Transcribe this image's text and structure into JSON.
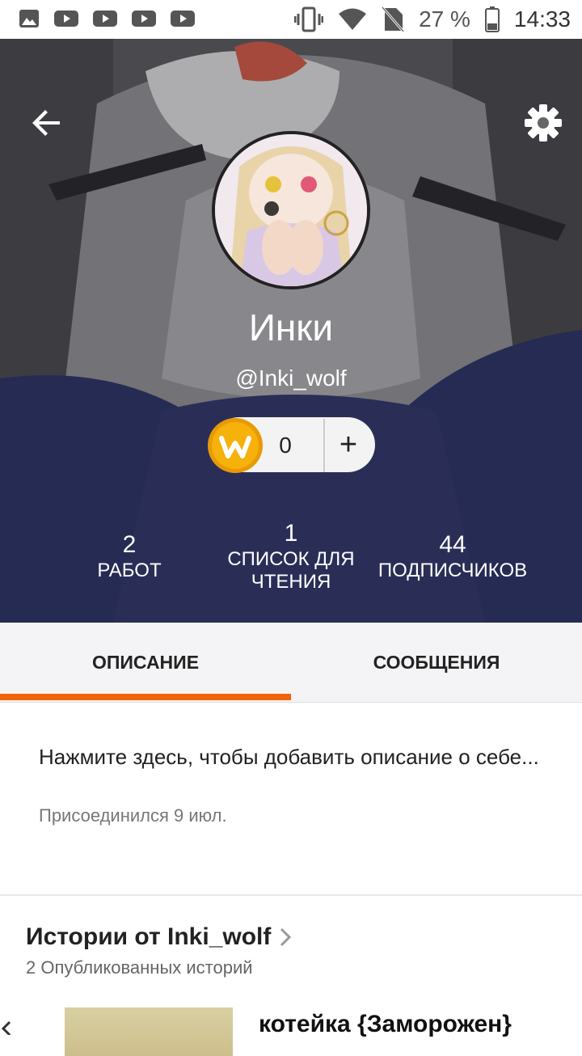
{
  "status_bar": {
    "battery": "27 %",
    "time": "14:33"
  },
  "profile": {
    "display_name": "Инки",
    "username": "@Inki_wolf",
    "coins": "0",
    "coin_add": "+"
  },
  "stats": [
    {
      "value": "2",
      "label": "РАБОТ"
    },
    {
      "value": "1",
      "label": "СПИСОК ДЛЯ ЧТЕНИЯ"
    },
    {
      "value": "44",
      "label": "ПОДПИСЧИКОВ"
    }
  ],
  "tabs": [
    {
      "label": "ОПИСАНИЕ",
      "active": true
    },
    {
      "label": "СООБЩЕНИЯ",
      "active": false
    }
  ],
  "about": {
    "description_prompt": "Нажмите здесь, чтобы добавить описание о себе...",
    "joined": "Присоединился 9 июл."
  },
  "stories": {
    "heading": "Истории от Inki_wolf",
    "count_label": "2 Опубликованных историй",
    "items": [
      {
        "title": "котейка {Заморожен}"
      }
    ]
  },
  "colors": {
    "accent": "#f0620c",
    "coin": "#f6b10a"
  }
}
